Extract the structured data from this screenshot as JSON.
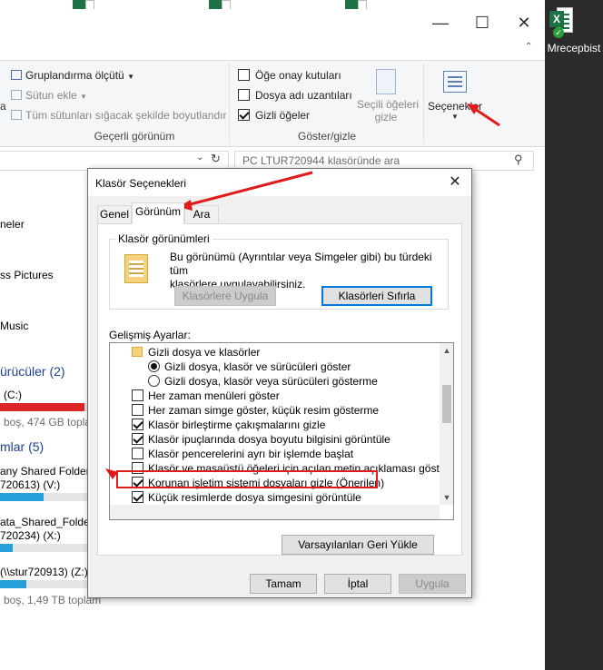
{
  "desktop": {
    "icon_label": "Mrecepbist",
    "excel_letter": "X"
  },
  "explorer": {
    "ribbon": {
      "group_by": "Gruplandırma ölçütü",
      "add_column": "Sütun ekle",
      "fit_columns": "Tüm sütunları sığacak şekilde boyutlandır",
      "current_view_label": "Geçerli görünüm",
      "item_checkboxes": "Öğe onay kutuları",
      "file_extensions": "Dosya adı uzantıları",
      "hidden_items": "Gizli öğeler",
      "hide_selected_line1": "Seçili öğeleri",
      "hide_selected_line2": "gizle",
      "options": "Seçenekler",
      "show_hide_label": "Göster/gizle",
      "item_checkboxes_checked": false,
      "file_extensions_checked": false,
      "hidden_items_checked": true
    },
    "search_placeholder": "PC LTUR720944 klasöründe ara",
    "nav": {
      "item1": "neler",
      "item2": "ss Pictures",
      "item3": "Music",
      "drives_header": "ürücüler (2)",
      "drive_c_name": "(C:)",
      "drive_c_free": "boş, 474 GB topla",
      "network_header": "mlar (5)",
      "net1_name": "any Shared Folder",
      "net1_sub": "720613) (V:)",
      "net2_name": "ata_Shared_Folders",
      "net2_sub": "720234) (X:)",
      "net3_name": "(\\\\stur720913) (Z:)",
      "net3_free": "boş, 1,49 TB toplam"
    }
  },
  "dialog": {
    "title": "Klasör Seçenekleri",
    "tabs": [
      "Genel",
      "Görünüm",
      "Ara"
    ],
    "active_tab": "Görünüm",
    "folder_views_legend": "Klasör görünümleri",
    "folder_views_desc_line1": "Bu görünümü (Ayrıntılar veya Simgeler gibi) bu türdeki tüm",
    "folder_views_desc_line2": "klasörlere uygulayabilirsiniz.",
    "apply_to_folders": "Klasörlere Uygula",
    "reset_folders": "Klasörleri Sıfırla",
    "advanced_label": "Gelişmiş Ayarlar:",
    "advanced_items": [
      {
        "kind": "folder",
        "label": "Gizli dosya ve klasörler"
      },
      {
        "kind": "radio",
        "checked": true,
        "label": "Gizli dosya, klasör ve sürücüleri göster"
      },
      {
        "kind": "radio",
        "checked": false,
        "label": "Gizli dosya, klasör veya sürücüleri gösterme"
      },
      {
        "kind": "check",
        "checked": false,
        "label": "Her zaman menüleri göster"
      },
      {
        "kind": "check",
        "checked": false,
        "label": "Her zaman simge göster, küçük resim gösterme"
      },
      {
        "kind": "check",
        "checked": true,
        "label": "Klasör birleştirme çakışmalarını gizle"
      },
      {
        "kind": "check",
        "checked": true,
        "label": "Klasör ipuçlarında dosya boyutu bilgisini görüntüle"
      },
      {
        "kind": "check",
        "checked": false,
        "label": "Klasör pencerelerini ayrı bir işlemde başlat"
      },
      {
        "kind": "check",
        "checked": false,
        "label": "Klasör ve masaüstü öğeleri için açılan metin açıklaması göster"
      },
      {
        "kind": "check",
        "checked": true,
        "label": "Korunan işletim sistemi dosyaları gizle (Önerilen)"
      },
      {
        "kind": "check",
        "checked": true,
        "label": "Küçük resimlerde dosya simgesini görüntüle"
      }
    ],
    "restore_defaults": "Varsayılanları Geri Yükle",
    "ok": "Tamam",
    "cancel": "İptal",
    "apply": "Uygula"
  },
  "colors": {
    "annotation_red": "#e01b1b",
    "drive_c_bar": "#da2626",
    "drive_bar_blue": "#26a0da",
    "section_header_blue": "#1e3f91"
  },
  "bars": {
    "drive_c_used": 0.97,
    "net1_used": 0.5,
    "net2_used": 0.15,
    "net3_used": 0.3
  }
}
